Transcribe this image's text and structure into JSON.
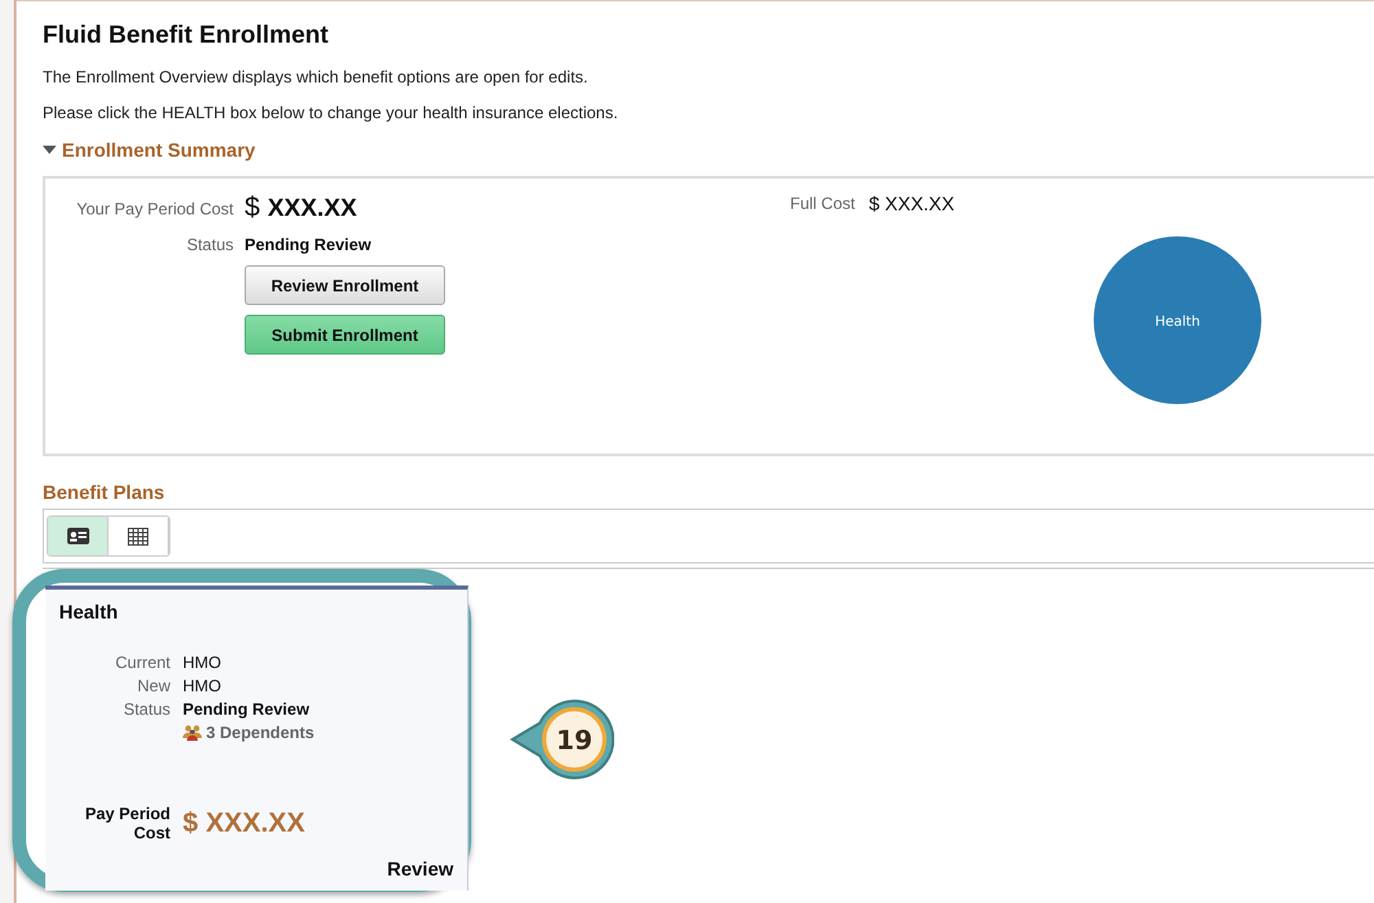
{
  "title": "Fluid Benefit Enrollment",
  "intro": [
    "The Enrollment Overview displays which benefit options are open for edits.",
    "Please click the HEALTH box below to change your health insurance elections."
  ],
  "summary": {
    "heading": "Enrollment Summary",
    "expanded": true,
    "pay_label": "Your Pay Period Cost",
    "pay_currency": "$",
    "pay_value": "XXX.XX",
    "status_label": "Status",
    "status_value": "Pending Review",
    "full_cost_label": "Full Cost",
    "full_cost_value": "$ XXX.XX",
    "buttons": [
      {
        "label": "Review Enrollment",
        "kind": "default"
      },
      {
        "label": "Submit Enrollment",
        "kind": "primary"
      }
    ],
    "cost_chart": {
      "slices": [
        {
          "label": "Health",
          "color": "#2a7db3"
        }
      ]
    }
  },
  "plans": {
    "heading": "Benefit Plans",
    "views": [
      {
        "kind": "card",
        "selected": true
      },
      {
        "kind": "grid",
        "selected": false
      }
    ],
    "card": {
      "title": "Health",
      "rows": [
        {
          "label": "Current",
          "value": "HMO"
        },
        {
          "label": "New",
          "value": "HMO"
        },
        {
          "label": "Status",
          "value": "Pending Review"
        }
      ],
      "dependents": "3 Dependents",
      "cost_label": "Pay Period Cost",
      "cost_currency": "$",
      "cost_value": "XXX.XX",
      "link": "Review"
    }
  },
  "callout": {
    "number": "19"
  }
}
